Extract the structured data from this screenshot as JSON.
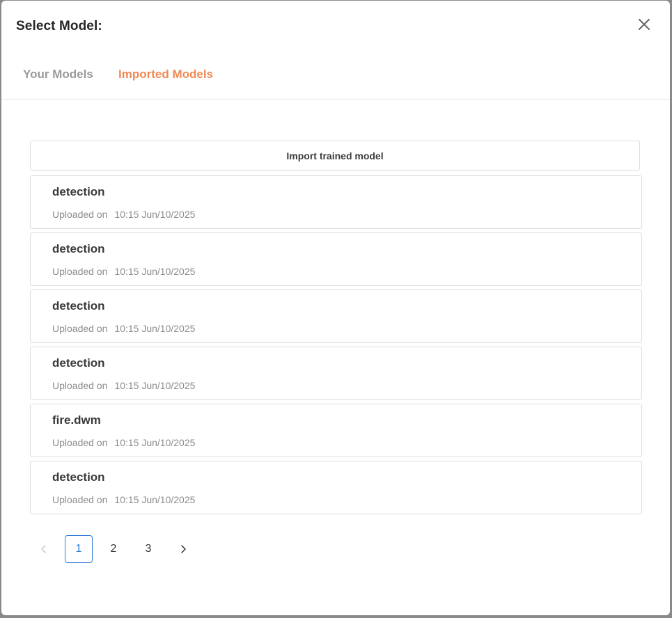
{
  "dialog": {
    "title": "Select Model:"
  },
  "tabs": [
    {
      "label": "Your Models",
      "active": false
    },
    {
      "label": "Imported Models",
      "active": true
    }
  ],
  "accent_color": "#ef8a55",
  "import_button": {
    "label": "Import trained model"
  },
  "models": [
    {
      "name": "detection",
      "uploaded_label": "Uploaded on",
      "date": "10:15 Jun/10/2025"
    },
    {
      "name": "detection",
      "uploaded_label": "Uploaded on",
      "date": "10:15 Jun/10/2025"
    },
    {
      "name": "detection",
      "uploaded_label": "Uploaded on",
      "date": "10:15 Jun/10/2025"
    },
    {
      "name": "detection",
      "uploaded_label": "Uploaded on",
      "date": "10:15 Jun/10/2025"
    },
    {
      "name": "fire.dwm",
      "uploaded_label": "Uploaded on",
      "date": "10:15 Jun/10/2025"
    },
    {
      "name": "detection",
      "uploaded_label": "Uploaded on",
      "date": "10:15 Jun/10/2025"
    }
  ],
  "pagination": {
    "pages": [
      "1",
      "2",
      "3"
    ],
    "current": "1",
    "prev_icon": "chevron-left-icon",
    "next_icon": "chevron-right-icon"
  }
}
